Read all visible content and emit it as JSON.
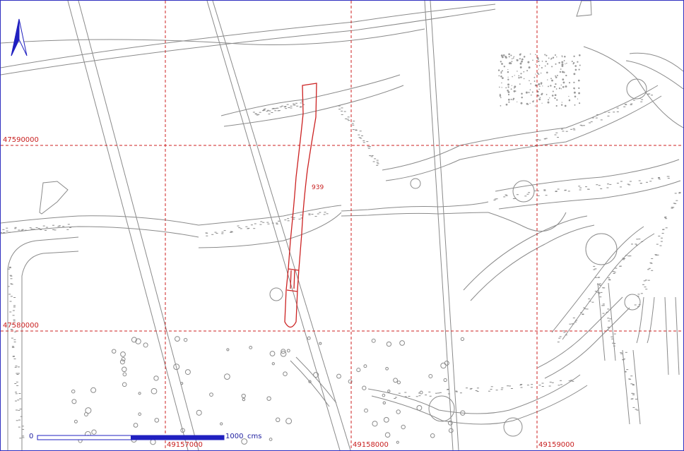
{
  "map": {
    "grid": {
      "easting_labels": [
        "49157000",
        "49158000",
        "49159000"
      ],
      "northing_labels": [
        "47590000",
        "47580000"
      ],
      "grid_color": "#cc2222",
      "grid_style": "dashed"
    },
    "feature": {
      "id_label": "939",
      "highlight_color": "#cc2222"
    },
    "scale_bar": {
      "start_label": "0",
      "end_label": "1000",
      "unit_label": "cms",
      "bar_color": "#2020c0"
    },
    "north_arrow": {
      "icon": "north-arrow-icon",
      "color": "#2020c0"
    },
    "line_color": "#8a8a8a",
    "frame_color": "#3030c0"
  }
}
